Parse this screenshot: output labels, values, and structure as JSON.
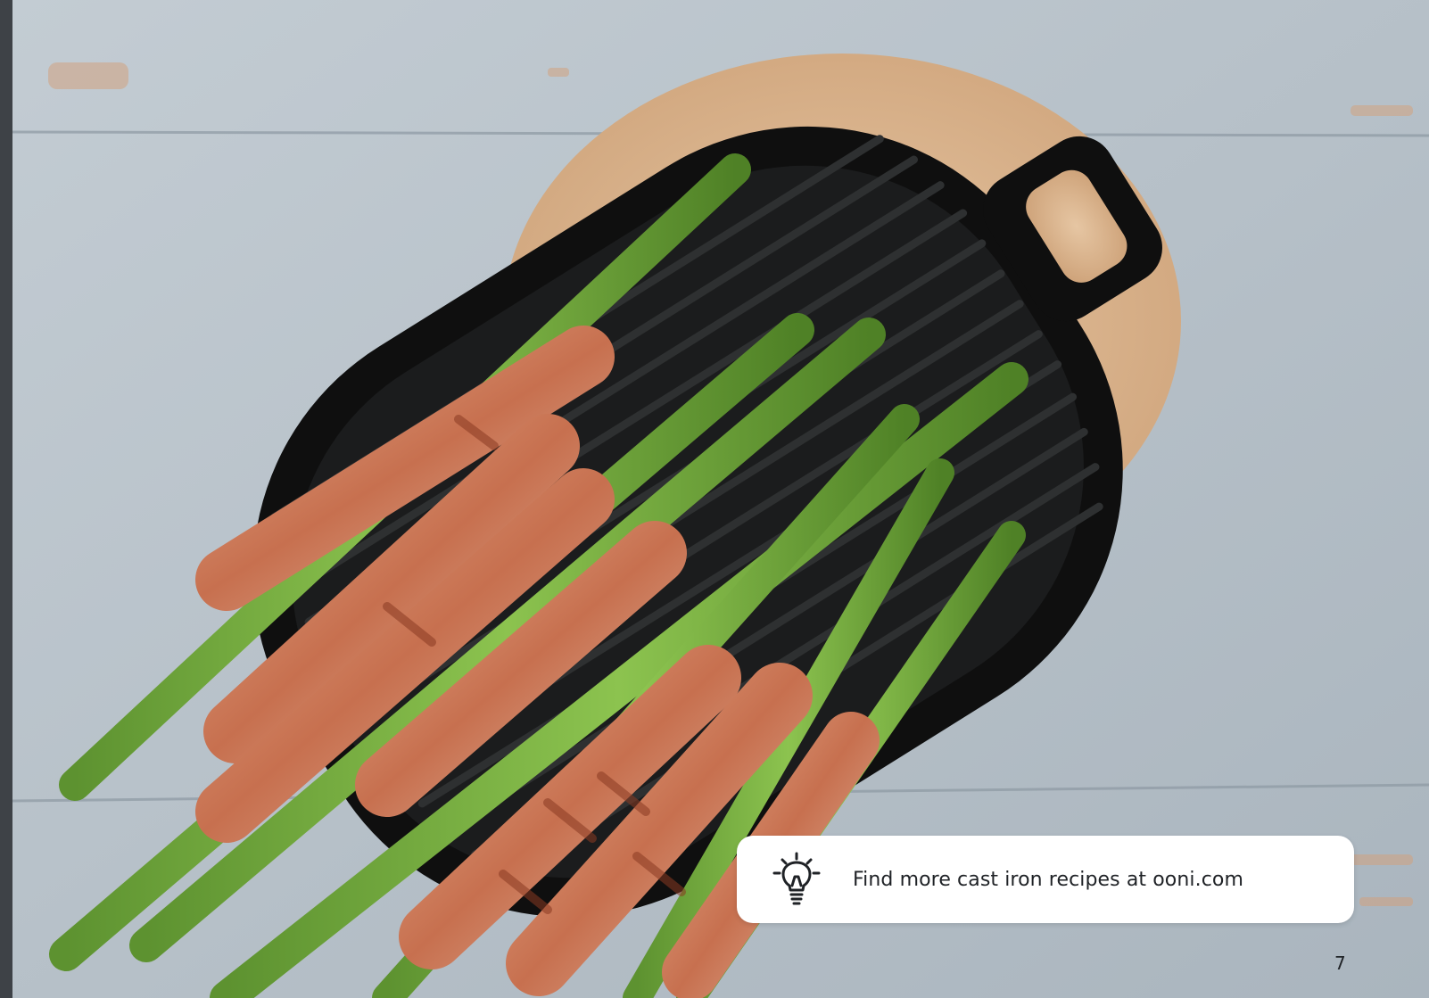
{
  "photo": {
    "subject": "Bacon-wrapped asparagus on a cast iron grill pan over a wooden board",
    "colors": {
      "table": "#b9c3cb",
      "board": "#d9b48f",
      "pan": "#141414",
      "asparagus": "#6ea33a",
      "prosciutto": "#c98a6e"
    }
  },
  "tip": {
    "icon": "lightbulb-icon",
    "text": "Find more cast iron recipes at ooni.com"
  },
  "page_number": "7"
}
